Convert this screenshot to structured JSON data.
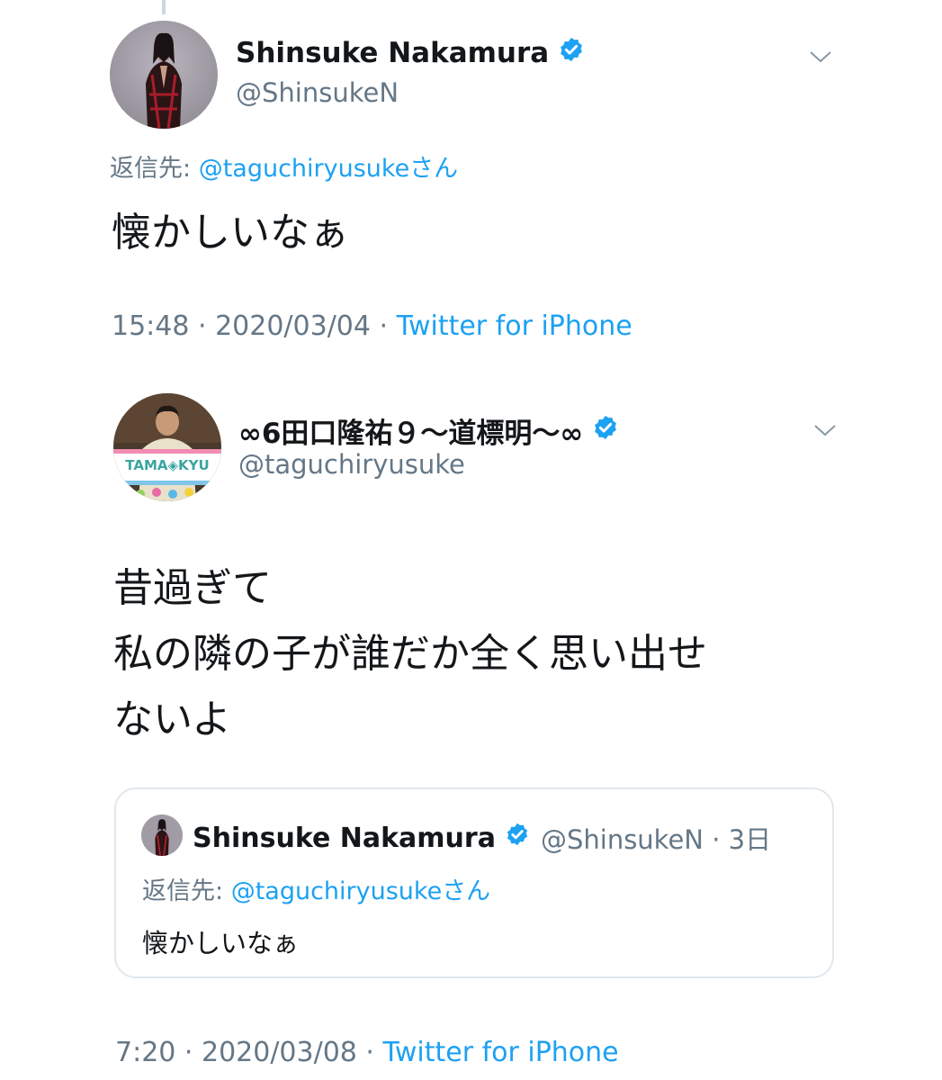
{
  "tweet1": {
    "display_name": "Shinsuke Nakamura",
    "handle": "@ShinsukeN",
    "reply_label": "返信先: ",
    "reply_mention": "@taguchiryusukeさん",
    "text": "懐かしいなぁ",
    "time": "15:48 · 2020/03/04 · ",
    "source": "Twitter for iPhone"
  },
  "tweet2": {
    "display_name": "∞6田口隆祐９〜道標明〜∞",
    "handle": "@taguchiryusuke",
    "avatar_banner_text": "TAMA◈KYU",
    "text_lines": [
      "昔過ぎて",
      "私の隣の子が誰だか全く思い出せ",
      "ないよ"
    ],
    "time": "7:20 · 2020/03/08 · ",
    "source": "Twitter for iPhone"
  },
  "quote": {
    "display_name": "Shinsuke Nakamura",
    "handle_age": "@ShinsukeN · 3日",
    "reply_label": "返信先: ",
    "reply_mention": "@taguchiryusukeさん",
    "text": "懐かしいなぁ"
  },
  "colors": {
    "accent": "#1da1f2",
    "secondary_text": "#657786",
    "primary_text": "#14171a",
    "border": "#e1e8ed"
  },
  "icons": {
    "verified": "verified-badge-icon",
    "chevron": "chevron-down-icon"
  }
}
